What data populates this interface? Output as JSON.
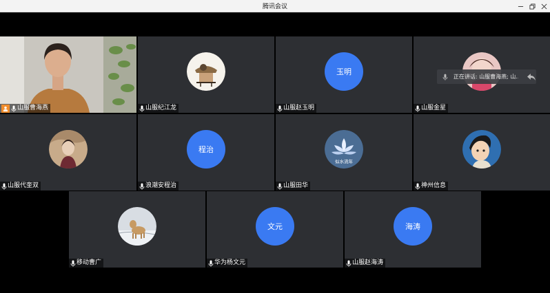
{
  "window": {
    "title": "腾讯会议"
  },
  "speaking": {
    "text": "正在讲话: 山服曹海燕; 山..."
  },
  "participants": [
    {
      "name": "山服曹海燕",
      "host": true,
      "video": true
    },
    {
      "name": "山服纪江龙",
      "avatar_icon": "avatar-photo-icon"
    },
    {
      "name": "山服赵玉明",
      "initials": "玉明"
    },
    {
      "name": "山服金星",
      "avatar_icon": "avatar-photo-icon"
    },
    {
      "name": "山服代奎双",
      "avatar_icon": "avatar-photo-icon"
    },
    {
      "name": "浪潮安程治",
      "initials": "程治"
    },
    {
      "name": "山服田华",
      "avatar_icon": "lotus-avatar-icon",
      "avatar_text": "似水流年"
    },
    {
      "name": "神州信息",
      "avatar_icon": "cartoon-avatar-icon"
    },
    {
      "name": "移动曹广",
      "avatar_icon": "dog-avatar-icon"
    },
    {
      "name": "华为杨文元",
      "initials": "文元"
    },
    {
      "name": "山服赵海涛",
      "initials": "海涛"
    }
  ],
  "colors": {
    "accent": "#3a7af2",
    "tile_bg": "#2d2f33",
    "host_badge": "#f08c2b",
    "active_border": "#3aa856"
  }
}
